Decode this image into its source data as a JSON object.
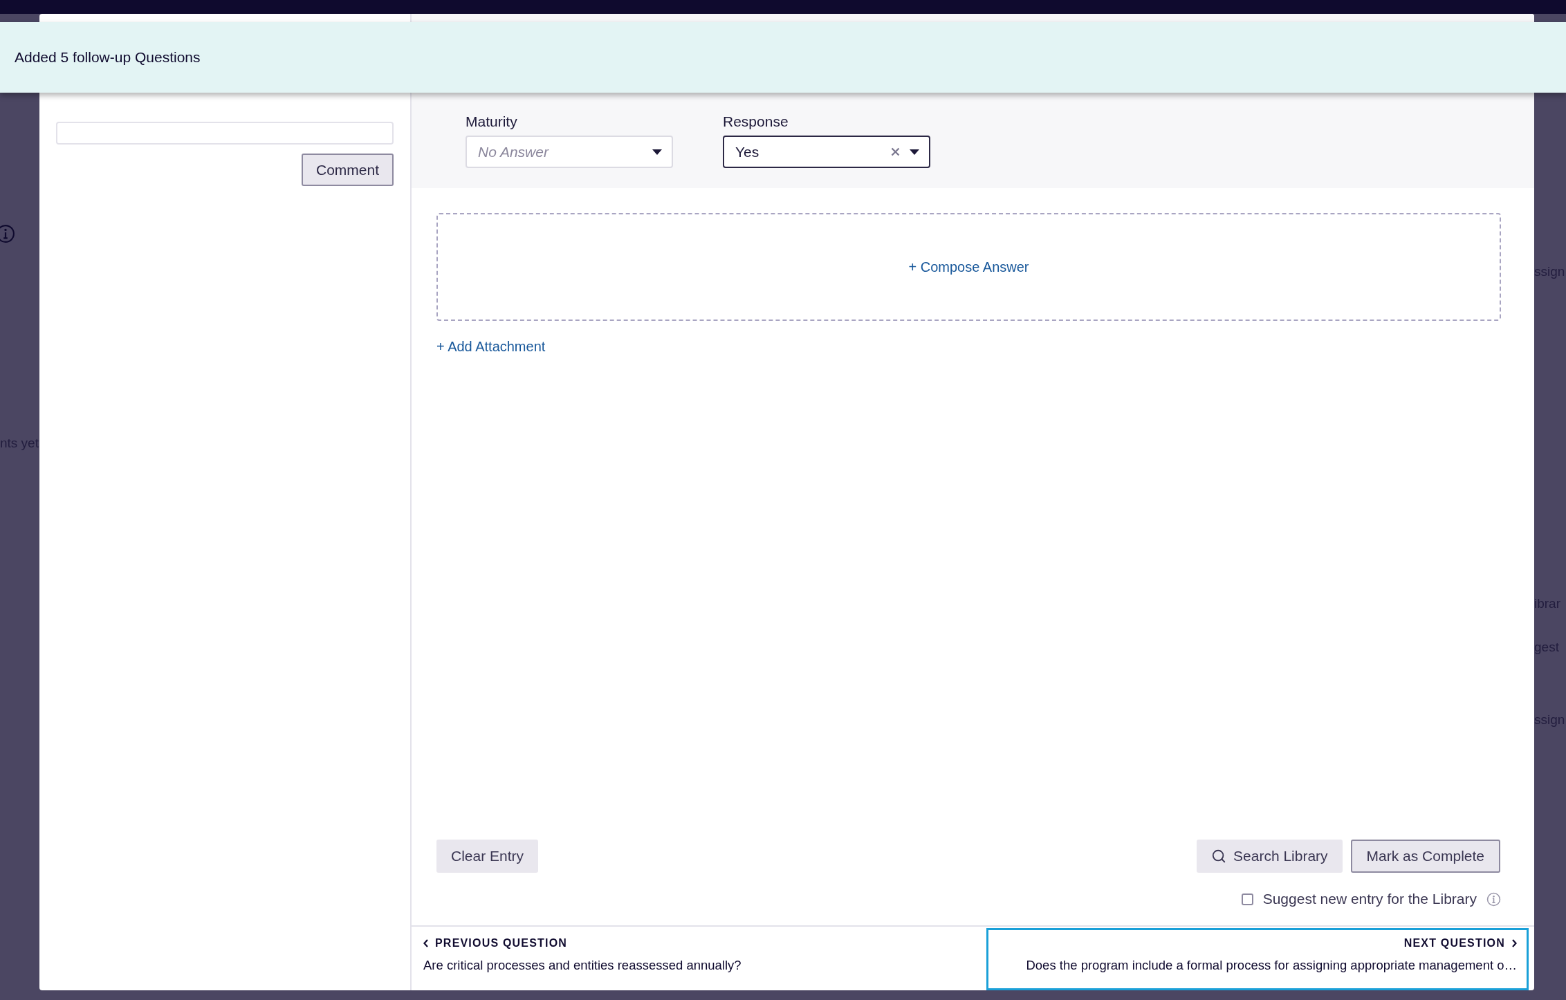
{
  "background": {
    "left_text": "nts yet",
    "right_texts": [
      "ssign",
      "ibrar",
      "gest",
      "ssign"
    ]
  },
  "toast": {
    "message": "Added 5 follow-up Questions"
  },
  "comments": {
    "button": "Comment"
  },
  "fields": [
    {
      "label": "Maturity",
      "placeholder": "No Answer",
      "clearable": false,
      "focused": false
    },
    {
      "label": "Response",
      "value": "Yes",
      "clearable": true,
      "focused": true
    }
  ],
  "compose": "+ Compose Answer",
  "add_attachment": "+ Add Attachment",
  "actions": {
    "clear": "Clear Entry",
    "search": "Search Library",
    "complete": "Mark as Complete"
  },
  "suggest": {
    "label": "Suggest new entry for the Library",
    "checked": false
  },
  "nav": [
    {
      "heading": "PREVIOUS QUESTION",
      "question": "Are critical processes and entities reassessed annually?",
      "selected": false
    },
    {
      "heading": "NEXT QUESTION",
      "question": "Does the program include a formal process for assigning appropriate management o…",
      "selected": true
    }
  ]
}
